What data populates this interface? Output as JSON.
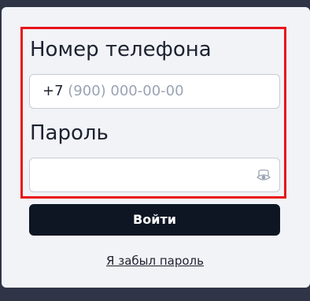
{
  "form": {
    "phone_label": "Номер телефона",
    "phone_prefix": "+7 ",
    "phone_mask": "(900) 000-00-00",
    "password_label": "Пароль",
    "password_value": "",
    "login_button": "Войти",
    "forgot_link": "Я забыл пароль"
  },
  "colors": {
    "highlight": "#e8141b",
    "button_bg": "#0e1624",
    "card_bg": "#f2f3f7",
    "background": "#2f3547"
  },
  "icons": {
    "password_toggle": "eye-icon"
  }
}
